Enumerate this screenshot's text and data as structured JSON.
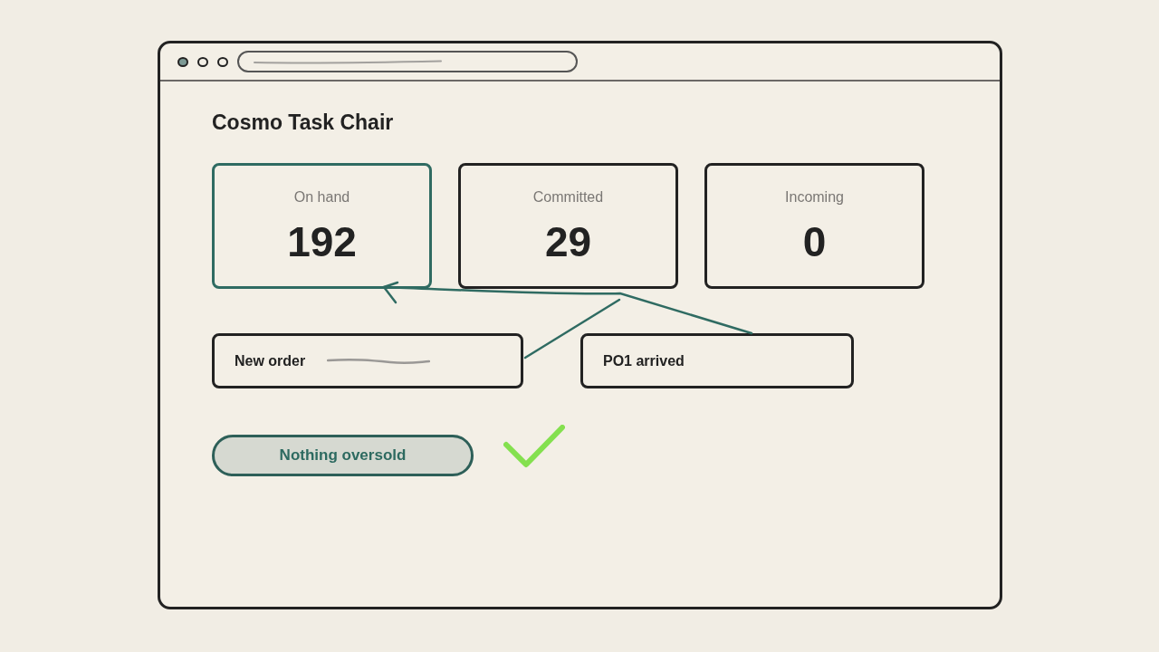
{
  "title": "Cosmo Task Chair",
  "metrics": [
    {
      "label": "On hand",
      "value": "192",
      "selected": true
    },
    {
      "label": "Committed",
      "value": "29",
      "selected": false
    },
    {
      "label": "Incoming",
      "value": "0",
      "selected": false
    }
  ],
  "events": [
    {
      "label": "New order",
      "scribble": true
    },
    {
      "label": "PO1 arrived",
      "scribble": false
    }
  ],
  "status": {
    "label": "Nothing oversold",
    "ok": true
  }
}
